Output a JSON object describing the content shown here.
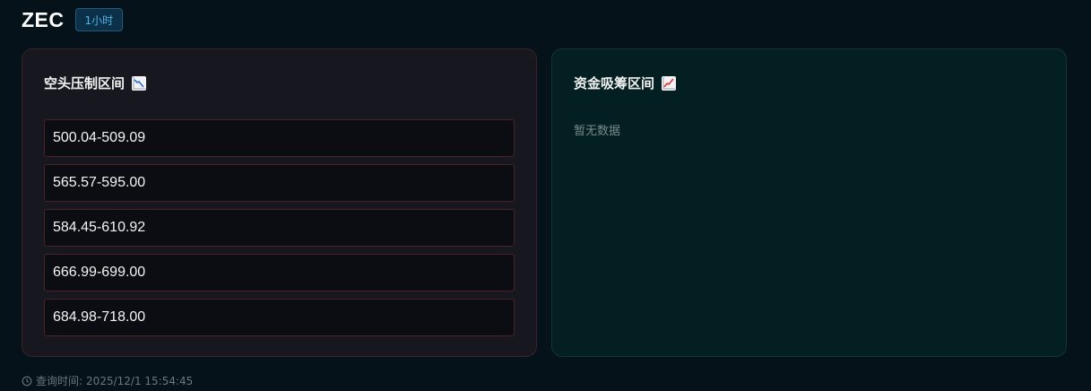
{
  "header": {
    "symbol": "ZEC",
    "timeframe": "1小时"
  },
  "short_panel": {
    "title": "空头压制区间",
    "icon": "chart-decreasing-icon",
    "zones": [
      "500.04-509.09",
      "565.57-595.00",
      "584.45-610.92",
      "666.99-699.00",
      "684.98-718.00"
    ]
  },
  "long_panel": {
    "title": "资金吸筹区间",
    "icon": "chart-increasing-icon",
    "empty_text": "暂无数据"
  },
  "footer": {
    "icon": "clock-icon",
    "query_time_label": "查询时间:",
    "query_time": "2025/12/1 15:54:45"
  },
  "colors": {
    "page_bg": "#06121a",
    "short_panel_bg": "#17181f",
    "short_border": "#4a2328",
    "long_panel_bg": "#031f21",
    "badge_text": "#4fb3e6"
  }
}
